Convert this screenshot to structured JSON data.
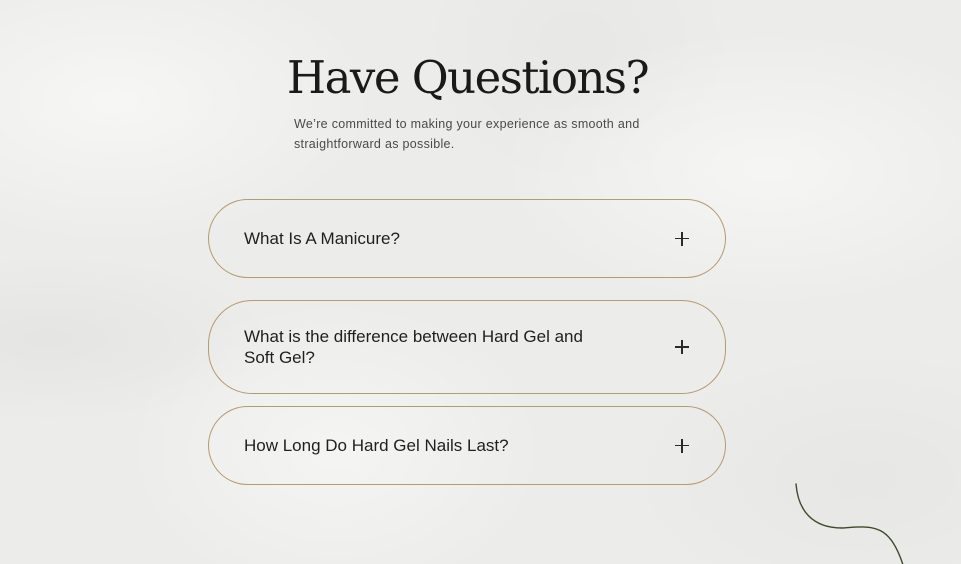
{
  "faq": {
    "title": "Have Questions?",
    "intro": "We’re committed to making your experience as smooth and straightforward as possible.",
    "items": [
      {
        "question": "What Is A Manicure?",
        "icon": "plus-icon",
        "expanded": false
      },
      {
        "question": "What is the difference between Hard Gel and Soft Gel?",
        "icon": "plus-icon",
        "expanded": false
      },
      {
        "question": "How Long Do Hard Gel Nails Last?",
        "icon": "plus-icon",
        "expanded": false
      }
    ]
  },
  "colors": {
    "background": "#ececea",
    "item_border": "#b69a72",
    "text": "#1f1f1f",
    "decor_line": "#3d4a2a"
  }
}
